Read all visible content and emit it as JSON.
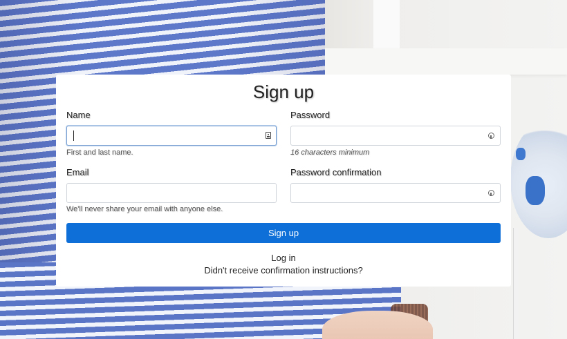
{
  "form": {
    "title": "Sign up",
    "name_label": "Name",
    "name_value": "",
    "name_help": "First and last name.",
    "email_label": "Email",
    "email_value": "",
    "email_help": "We'll never share your email with anyone else.",
    "password_label": "Password",
    "password_value": "",
    "password_help": "16 characters minimum",
    "password_confirmation_label": "Password confirmation",
    "password_confirmation_value": "",
    "submit_label": "Sign up",
    "login_link": "Log in",
    "confirmation_link": "Didn't receive confirmation instructions?"
  },
  "icons": {
    "name_field_icon": "contact-card-icon",
    "password_field_icon": "password-key-icon",
    "password_confirmation_field_icon": "password-key-icon"
  },
  "colors": {
    "primary_button": "#0e6fd8",
    "card_background": "#ffffff",
    "focus_border": "#7fa4d3"
  }
}
